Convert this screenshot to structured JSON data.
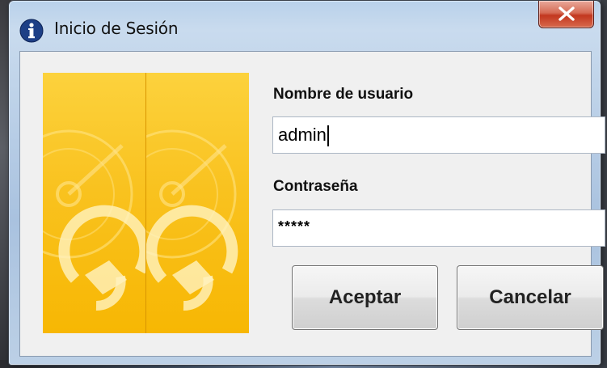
{
  "window": {
    "title": "Inicio de Sesión",
    "close_icon": "close-icon",
    "title_icon": "info-icon"
  },
  "form": {
    "username_label": "Nombre de usuario",
    "username_value": "admin",
    "password_label": "Contraseña",
    "password_value": "*****"
  },
  "buttons": {
    "accept_label": "Aceptar",
    "cancel_label": "Cancelar"
  },
  "colors": {
    "banner_yellow": "#f7b703",
    "close_red": "#c2371f",
    "titlebar_blue": "#b9d1ea"
  }
}
